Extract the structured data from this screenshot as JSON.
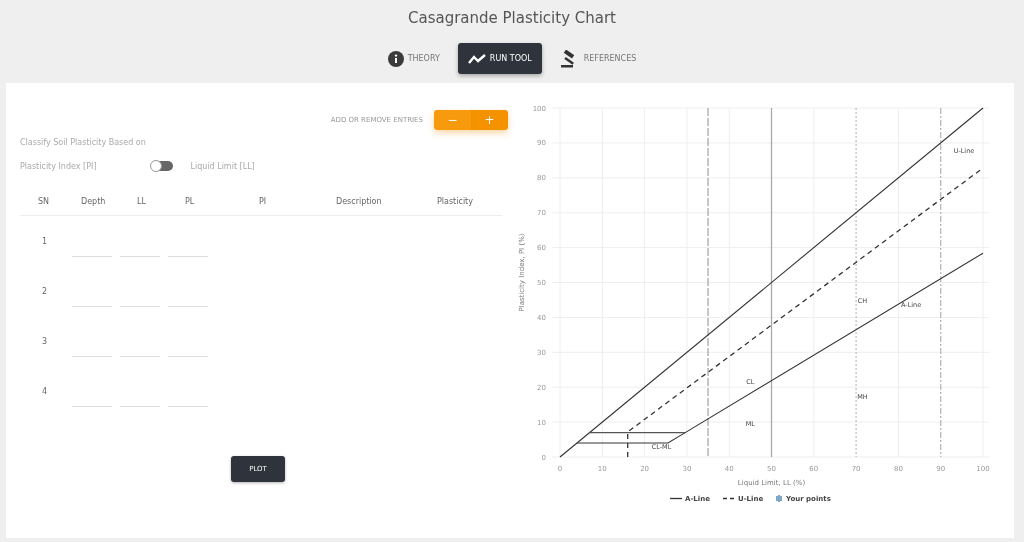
{
  "title": "Casagrande Plasticity Chart",
  "tabs": [
    {
      "label": "THEORY",
      "selected": false
    },
    {
      "label": "RUN TOOL",
      "selected": true
    },
    {
      "label": "REFERENCES",
      "selected": false
    }
  ],
  "entries": {
    "label": "ADD OR REMOVE ENTRIES",
    "buttons": [
      "−",
      "+"
    ]
  },
  "classify": {
    "label": "Classify Soil Plasticity Based on",
    "left_option": "Plasticity Index [PI]",
    "right_option": "Liquid Limit [LL]",
    "on": false
  },
  "table": {
    "columns": [
      "SN",
      "Depth",
      "LL",
      "PL",
      "PI",
      "Description",
      "Plasticity"
    ],
    "rows": [
      {
        "sn": "1"
      },
      {
        "sn": "2"
      },
      {
        "sn": "3"
      },
      {
        "sn": "4"
      }
    ]
  },
  "plot_button": "PLOT",
  "chart": {
    "chart_data": {
      "type": "line",
      "xlabel": "Liquid Limit, LL (%)",
      "ylabel": "Plasticity Index, PI (%)",
      "xlim": [
        0,
        100
      ],
      "ylim": [
        0,
        100
      ],
      "xticks": [
        0,
        10,
        20,
        30,
        40,
        50,
        60,
        70,
        80,
        90,
        100
      ],
      "yticks": [
        0,
        10,
        20,
        30,
        40,
        50,
        60,
        70,
        80,
        90,
        100
      ],
      "grid": true,
      "legend": "bottom",
      "series": [
        {
          "name": "A-Line",
          "color": "#333333",
          "line_style": "solid",
          "x": [
            4,
            25.5,
            29.6,
            100
          ],
          "values": [
            4,
            4,
            7,
            58.4
          ]
        },
        {
          "name": "U-Line",
          "color": "#333333",
          "line_style": "dashed",
          "x": [
            16,
            16,
            100
          ],
          "values": [
            0,
            7.2,
            82.8
          ]
        },
        {
          "name": "Your points",
          "color": "#7fa7c9"
        },
        {
          "color": "#333333",
          "line_style": "solid",
          "x": [
            0,
            100
          ],
          "values": [
            0,
            100
          ]
        },
        {
          "color": "#555555",
          "line_style": "solid",
          "x": [
            7,
            29.6
          ],
          "values": [
            7,
            7
          ]
        }
      ],
      "ref_lines": [
        {
          "axis": "x",
          "value": 35,
          "line_style": "dashed"
        },
        {
          "axis": "x",
          "value": 50,
          "line_style": "solid"
        },
        {
          "axis": "x",
          "value": 70,
          "line_style": "dotted"
        },
        {
          "axis": "x",
          "value": 90,
          "line_style": "dashdot"
        }
      ],
      "annotations": [
        "U-Line",
        "A-Line",
        "CH",
        "CL",
        "MH",
        "ML",
        "CL-ML"
      ]
    }
  }
}
